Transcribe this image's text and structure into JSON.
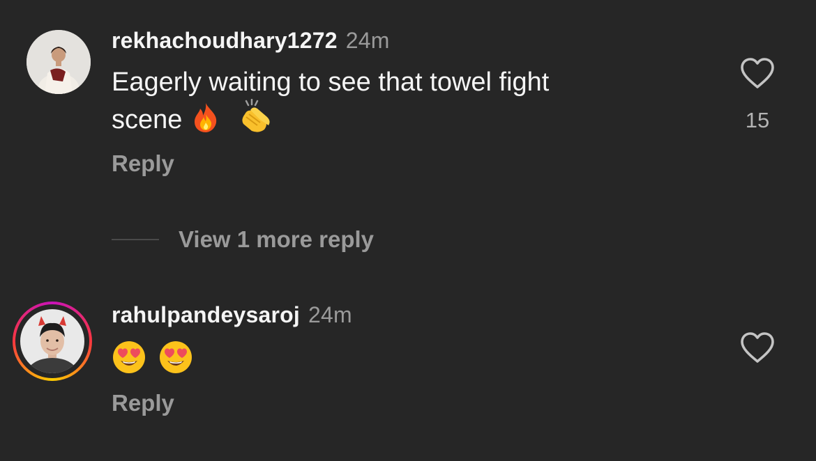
{
  "colors": {
    "background": "#262626",
    "primary_text": "#f5f5f5",
    "secondary_text": "#9a9a9a",
    "story_ring": [
      "#c913b9",
      "#f9373f",
      "#fecd00"
    ]
  },
  "comments": [
    {
      "username": "rekhachoudhary1272",
      "time": "24m",
      "text_line1": "Eagerly waiting to see that towel fight",
      "text_line2": "scene",
      "emojis": [
        "fire-emoji",
        "clapping-hands-emoji"
      ],
      "reply_label": "Reply",
      "like_count": "15",
      "has_story_ring": false
    },
    {
      "username": "rahulpandeysaroj",
      "time": "24m",
      "emojis": [
        "heart-eyes-emoji",
        "heart-eyes-emoji"
      ],
      "reply_label": "Reply",
      "has_story_ring": true
    }
  ],
  "view_more_replies": "View 1 more reply"
}
